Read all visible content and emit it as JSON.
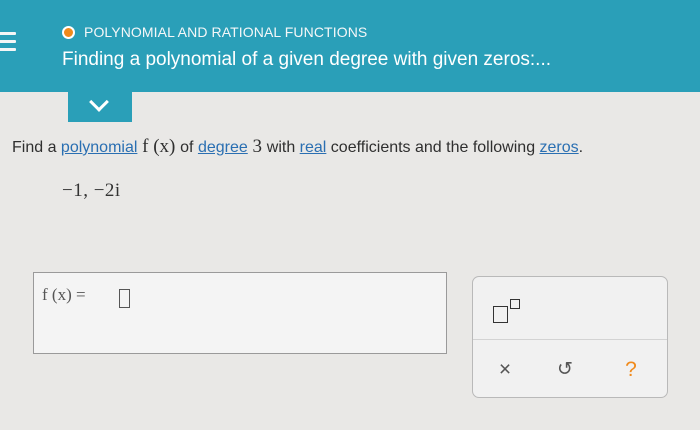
{
  "header": {
    "topic": "POLYNOMIAL AND RATIONAL FUNCTIONS",
    "title": "Finding a polynomial of a given degree with given zeros:...",
    "status_color": "#f08a1c",
    "bar_color": "#2a9fb8"
  },
  "question": {
    "part1": "Find a ",
    "link_polynomial": "polynomial",
    "math_fx": " f (x) ",
    "part2": "of ",
    "link_degree": "degree",
    "math_3": " 3 ",
    "part3": "with ",
    "link_real": "real",
    "part4": " coefficients and the following ",
    "link_zeros": "zeros",
    "part5": "."
  },
  "zeros": "−1, −2i",
  "answer": {
    "label": "f (x) =",
    "value": ""
  },
  "tools": {
    "exponent_icon": "superscript-template-icon",
    "clear": "×",
    "undo": "↺",
    "help": "?"
  }
}
